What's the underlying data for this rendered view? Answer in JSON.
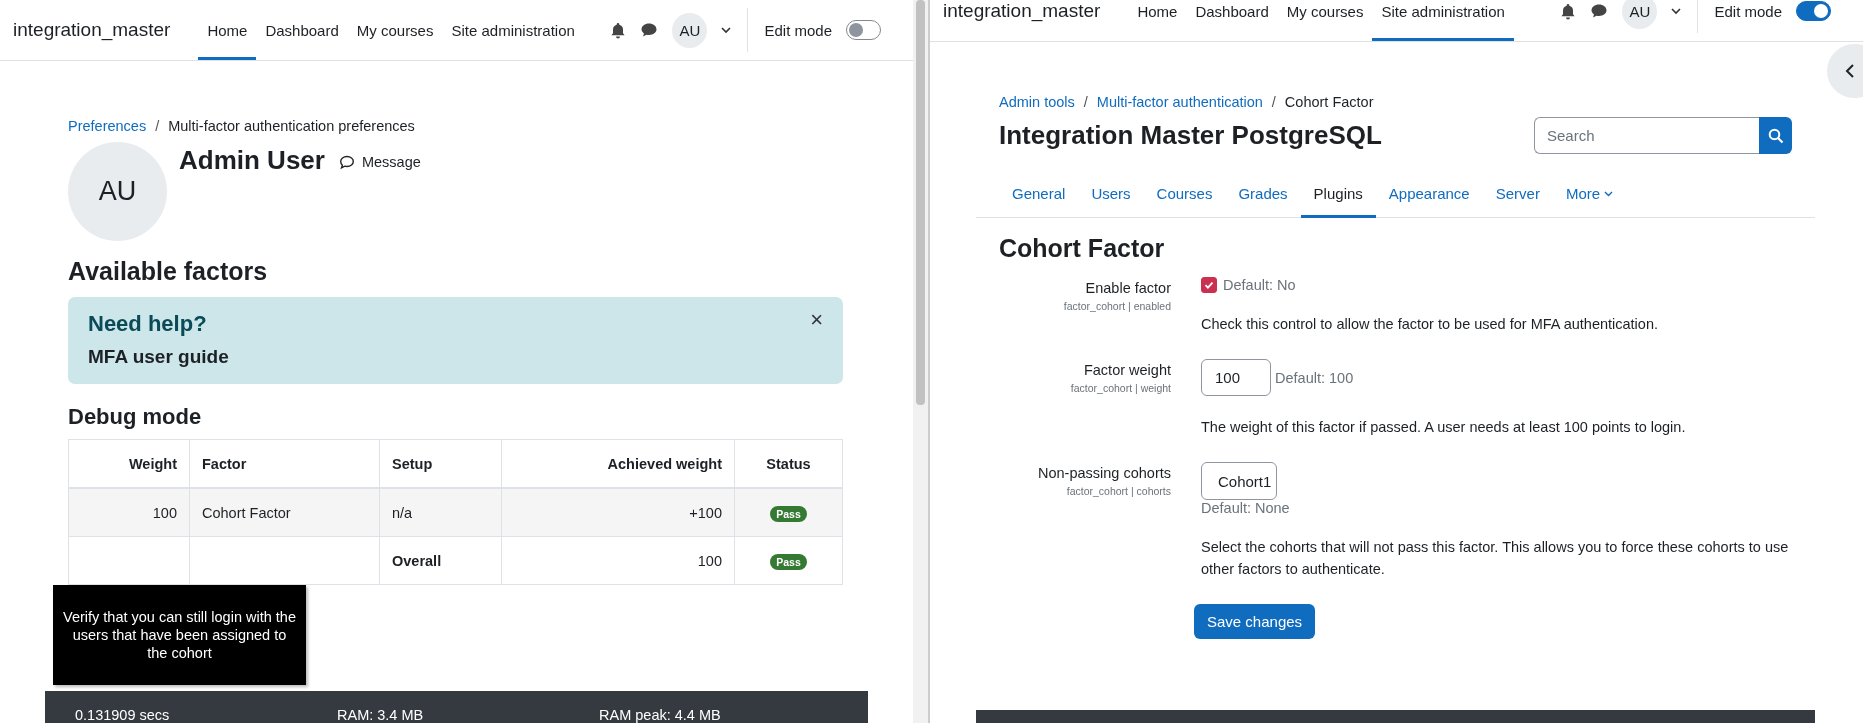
{
  "left_window": {
    "header": {
      "brand": "integration_master",
      "nav": [
        {
          "label": "Home",
          "selected": true
        },
        {
          "label": "Dashboard",
          "selected": false
        },
        {
          "label": "My courses",
          "selected": false
        },
        {
          "label": "Site administration",
          "selected": false
        }
      ],
      "avatar": "AU",
      "edit_mode": {
        "label": "Edit mode",
        "on": false
      }
    },
    "breadcrumb": [
      {
        "kind": "link",
        "label": "Preferences"
      },
      {
        "kind": "separator",
        "label": "/"
      },
      {
        "kind": "current",
        "label": "Multi-factor authentication preferences"
      }
    ],
    "profile": {
      "initials": "AU",
      "name": "Admin User",
      "message": "Message"
    },
    "heading": "Available factors",
    "help_alert": {
      "title": "Need help?",
      "link": "MFA user guide",
      "close": "×"
    },
    "debug": {
      "heading": "Debug mode",
      "columns": [
        "Weight",
        "Factor",
        "Setup",
        "Achieved weight",
        "Status"
      ],
      "rows": [
        {
          "kind": "factor",
          "weight": "100",
          "factor": "Cohort Factor",
          "setup": "n/a",
          "achieved": "+100",
          "status": "Pass"
        },
        {
          "kind": "total",
          "weight": "",
          "factor": "",
          "setup": "Overall",
          "achieved": "100",
          "status": "Pass"
        }
      ]
    },
    "tooltip": "Verify that you can still login with the users that have been assigned to the cohort",
    "footer": [
      "0.131909 secs",
      "RAM: 3.4 MB",
      "RAM peak: 4.4 MB"
    ]
  },
  "right_window": {
    "header": {
      "brand": "integration_master",
      "nav": [
        {
          "label": "Home",
          "selected": false
        },
        {
          "label": "Dashboard",
          "selected": false
        },
        {
          "label": "My courses",
          "selected": false
        },
        {
          "label": "Site administration",
          "selected": true
        }
      ],
      "avatar": "AU",
      "edit_mode": {
        "label": "Edit mode",
        "on": true
      }
    },
    "breadcrumb": [
      {
        "kind": "link",
        "label": "Admin tools"
      },
      {
        "kind": "separator",
        "label": "/"
      },
      {
        "kind": "link",
        "label": "Multi-factor authentication"
      },
      {
        "kind": "separator",
        "label": "/"
      },
      {
        "kind": "current",
        "label": "Cohort Factor"
      }
    ],
    "site_title": "Integration Master PostgreSQL",
    "search": {
      "placeholder": "Search"
    },
    "tabs": [
      {
        "label": "General",
        "selected": false,
        "kind": "tab"
      },
      {
        "label": "Users",
        "selected": false,
        "kind": "tab"
      },
      {
        "label": "Courses",
        "selected": false,
        "kind": "tab"
      },
      {
        "label": "Grades",
        "selected": false,
        "kind": "tab"
      },
      {
        "label": "Plugins",
        "selected": true,
        "kind": "tab"
      },
      {
        "label": "Appearance",
        "selected": false,
        "kind": "tab"
      },
      {
        "label": "Server",
        "selected": false,
        "kind": "tab"
      },
      {
        "label": "More",
        "selected": false,
        "kind": "menu"
      }
    ],
    "heading": "Cohort Factor",
    "settings": [
      {
        "kind": "checkbox",
        "label": "Enable factor",
        "key": "factor_cohort | enabled",
        "checked": true,
        "default": "Default: No",
        "description": "Check this control to allow the factor to be used for MFA authentication."
      },
      {
        "kind": "text",
        "label": "Factor weight",
        "key": "factor_cohort | weight",
        "value": "100",
        "default": "Default: 100",
        "description": "The weight of this factor if passed. A user needs at least 100 points to login."
      },
      {
        "kind": "select",
        "label": "Non-passing cohorts",
        "key": "factor_cohort | cohorts",
        "value": "Cohort1",
        "default": "Default: None",
        "description": "Select the cohorts that will not pass this factor. This allows you to force these cohorts to use other factors to authenticate."
      }
    ],
    "save_button": "Save changes"
  }
}
